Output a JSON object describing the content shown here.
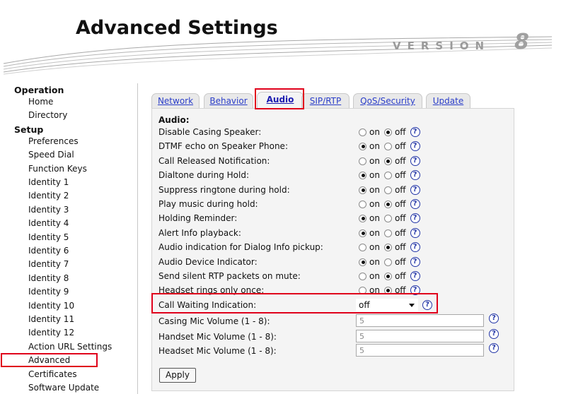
{
  "header": {
    "title": "Advanced Settings",
    "version_label": "VERSION",
    "version_number": "8"
  },
  "sidebar": {
    "groups": [
      {
        "label": "Operation",
        "items": [
          "Home",
          "Directory"
        ]
      },
      {
        "label": "Setup",
        "items": [
          "Preferences",
          "Speed Dial",
          "Function Keys",
          "Identity 1",
          "Identity 2",
          "Identity 3",
          "Identity 4",
          "Identity 5",
          "Identity 6",
          "Identity 7",
          "Identity 8",
          "Identity 9",
          "Identity 10",
          "Identity 11",
          "Identity 12",
          "Action URL Settings",
          "Advanced",
          "Certificates",
          "Software Update"
        ]
      }
    ],
    "selected": "Advanced"
  },
  "tabs": [
    {
      "label": "Network",
      "active": false
    },
    {
      "label": "Behavior",
      "active": false
    },
    {
      "label": "Audio",
      "active": true
    },
    {
      "label": "SIP/RTP",
      "active": false
    },
    {
      "label": "QoS/Security",
      "active": false
    },
    {
      "label": "Update",
      "active": false
    }
  ],
  "audio": {
    "section_title": "Audio:",
    "on_label": "on",
    "off_label": "off",
    "help_glyph": "?",
    "settings": [
      {
        "label": "Disable Casing Speaker:",
        "value": "off"
      },
      {
        "label": "DTMF echo on Speaker Phone:",
        "value": "on"
      },
      {
        "label": "Call Released Notification:",
        "value": "off"
      },
      {
        "label": "Dialtone during Hold:",
        "value": "on"
      },
      {
        "label": "Suppress ringtone during hold:",
        "value": "on"
      },
      {
        "label": "Play music during hold:",
        "value": "off"
      },
      {
        "label": "Holding Reminder:",
        "value": "on"
      },
      {
        "label": "Alert Info playback:",
        "value": "on"
      },
      {
        "label": "Audio indication for Dialog Info pickup:",
        "value": "off"
      },
      {
        "label": "Audio Device Indicator:",
        "value": "on"
      },
      {
        "label": "Send silent RTP packets on mute:",
        "value": "off"
      },
      {
        "label": "Headset rings only once:",
        "value": "off"
      }
    ],
    "call_waiting": {
      "label": "Call Waiting Indication:",
      "value": "off"
    },
    "volumes": [
      {
        "label": "Casing Mic Volume (1 - 8):",
        "value": "5"
      },
      {
        "label": "Handset Mic Volume (1 - 8):",
        "value": "5"
      },
      {
        "label": "Headset Mic Volume (1 - 8):",
        "value": "5"
      }
    ],
    "apply_label": "Apply"
  },
  "colors": {
    "highlight": "#e0001b",
    "link": "#2b3ec9",
    "help": "#2134a6"
  }
}
